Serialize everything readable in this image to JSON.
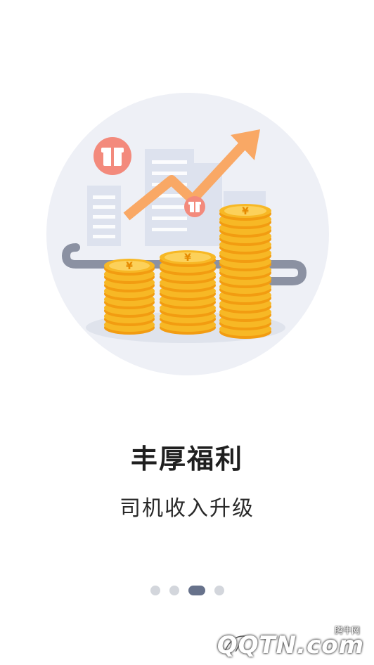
{
  "onboarding": {
    "title": "丰厚福利",
    "subtitle": "司机收入升级",
    "pager": {
      "total": 4,
      "active_index": 2
    }
  },
  "illustration": {
    "coin_symbol": "¥",
    "icons": [
      "gift-icon",
      "gift-icon",
      "rising-arrow-icon",
      "coin-stack-icon"
    ],
    "colors": {
      "circle_bg": "#eef0f6",
      "arrow": "#f9a865",
      "coin": "#f6b21d",
      "gift": "#f17668"
    }
  },
  "watermark": {
    "small_text": "腾牛网",
    "brand_text": "QQTN.com"
  }
}
